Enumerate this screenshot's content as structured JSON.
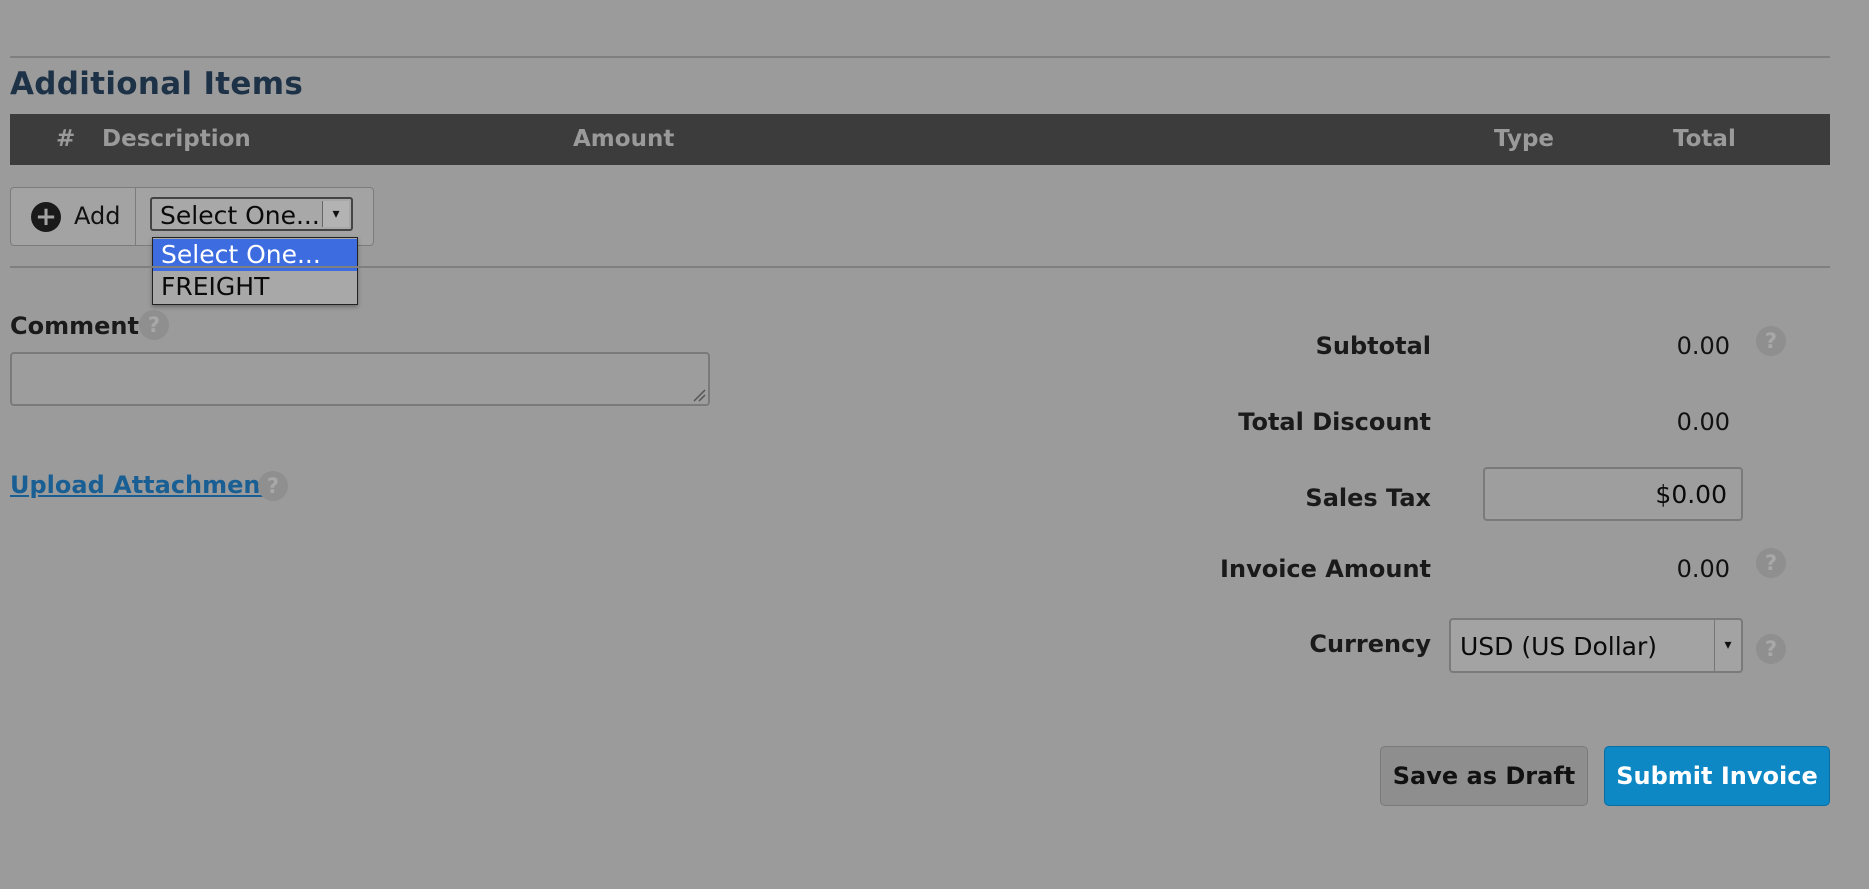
{
  "section": {
    "title": "Additional Items"
  },
  "table": {
    "headers": [
      "#",
      "Description",
      "Amount",
      "Type",
      "Total"
    ]
  },
  "add_row": {
    "add_label": "Add",
    "select_value": "Select One...",
    "options": [
      "Select One...",
      "FREIGHT"
    ]
  },
  "comment": {
    "label": "Comment",
    "value": ""
  },
  "upload": {
    "label": "Upload Attachment"
  },
  "summary": {
    "subtotal_label": "Subtotal",
    "subtotal_value": "0.00",
    "discount_label": "Total Discount",
    "discount_value": "0.00",
    "tax_label": "Sales Tax",
    "tax_value": "$0.00",
    "invoice_label": "Invoice Amount",
    "invoice_value": "0.00",
    "currency_label": "Currency",
    "currency_value": "USD (US Dollar)"
  },
  "actions": {
    "draft_label": "Save as Draft",
    "submit_label": "Submit Invoice"
  },
  "icons": {
    "help": "?",
    "plus": "+",
    "dropdown_arrow": "▾"
  },
  "colors": {
    "background": "#9b9b9b",
    "header_bar": "#3c3c3c",
    "title": "#1e3247",
    "link": "#1a5f94",
    "option_selected": "#3d6ce1",
    "submit": "#0e87c5"
  }
}
